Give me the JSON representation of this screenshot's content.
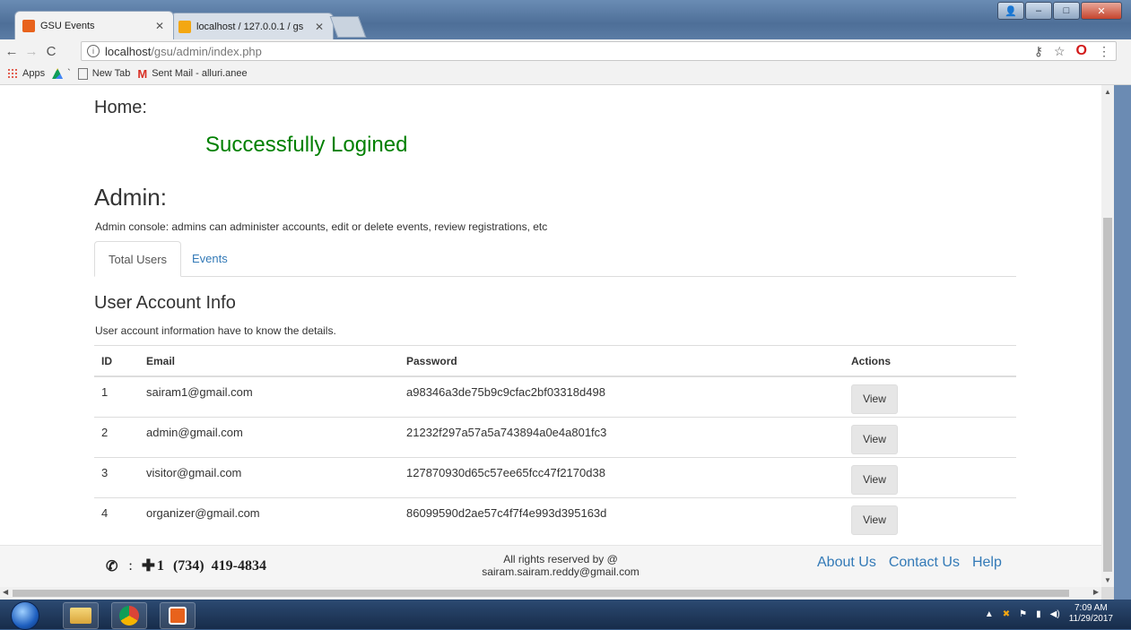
{
  "browser": {
    "tabs": [
      {
        "title": "GSU Events",
        "active": true
      },
      {
        "title": "localhost / 127.0.0.1 / gs",
        "active": false
      }
    ],
    "url_host": "localhost",
    "url_path": "/gsu/admin/index.php",
    "bookmarks": [
      "Apps",
      "New Tab",
      "Sent Mail - alluri.anee"
    ],
    "colors": {
      "brand_tab_icon": "#e8621c",
      "pma_icon": "#f3a712"
    }
  },
  "page": {
    "home_label": "Home:",
    "success_message": "Successfully Logined",
    "admin_title": "Admin:",
    "admin_description": "Admin console: admins can administer accounts, edit or delete events, review registrations, etc",
    "tabs": [
      {
        "label": "Total Users",
        "active": true
      },
      {
        "label": "Events",
        "active": false
      }
    ],
    "section_title": "User Account Info",
    "section_description": "User account information have to know the details.",
    "table": {
      "headers": [
        "ID",
        "Email",
        "Password",
        "Actions"
      ],
      "rows": [
        {
          "id": "1",
          "email": "sairam1@gmail.com",
          "password": "a98346a3de75b9c9cfac2bf03318d498",
          "action": "View"
        },
        {
          "id": "2",
          "email": "admin@gmail.com",
          "password": "21232f297a57a5a743894a0e4a801fc3",
          "action": "View"
        },
        {
          "id": "3",
          "email": "visitor@gmail.com",
          "password": "127870930d65c57ee65fcc47f2170d38",
          "action": "View"
        },
        {
          "id": "4",
          "email": "organizer@gmail.com",
          "password": "86099590d2ae57c4f7f4e993d395163d",
          "action": "View"
        }
      ]
    },
    "colors": {
      "success": "#008000",
      "link": "#337ab7"
    }
  },
  "footer": {
    "phone_prefix": "+1",
    "phone_number": "(734)  419-4834",
    "rights_line1": "All rights reserved by @",
    "rights_line2": "sairam.sairam.reddy@gmail.com",
    "links": [
      "About Us",
      "Contact Us",
      "Help"
    ]
  },
  "taskbar": {
    "time": "7:09 AM",
    "date": "11/29/2017"
  }
}
